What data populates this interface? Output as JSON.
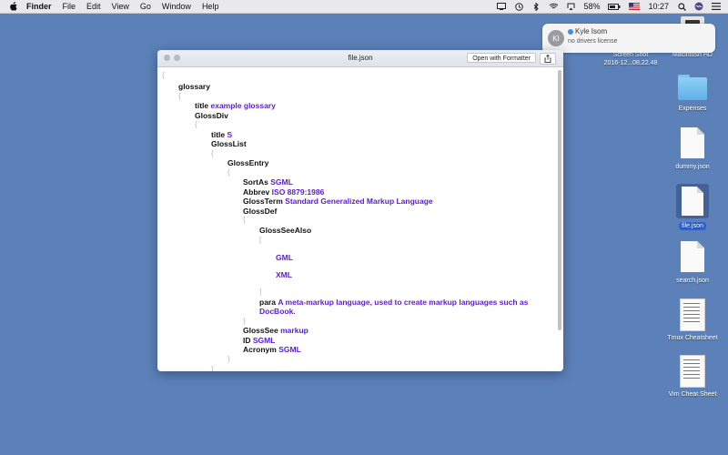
{
  "menubar": {
    "app_name": "Finder",
    "items": [
      "File",
      "Edit",
      "View",
      "Go",
      "Window",
      "Help"
    ],
    "battery": "58%",
    "time": "10:27"
  },
  "notification": {
    "initials": "KI",
    "title": "Kyle Isom",
    "message": "no drivers license"
  },
  "desktop": {
    "icons": [
      {
        "label_lines": [
          "Screen Shot",
          "2016-12...08.22.48"
        ]
      },
      {
        "label_lines": [
          "Macintosh HD"
        ]
      },
      {
        "label_lines": [
          "Expenses"
        ]
      },
      {
        "label_lines": [
          "dummy.json"
        ]
      },
      {
        "label_lines": [
          "file.json"
        ]
      },
      {
        "label_lines": [
          "search.json"
        ]
      },
      {
        "label_lines": [
          "Tmux Cheatsheet"
        ]
      },
      {
        "label_lines": [
          "Vim Cheat Sheet"
        ]
      }
    ]
  },
  "window": {
    "title": "file.json",
    "format_button": "Open with Formatter"
  },
  "json_tree": {
    "open_brace": "{",
    "close_brace": "}",
    "open_bracket": "[",
    "close_bracket": "]",
    "glossary_key": "glossary",
    "title_key": "title",
    "title_val": "example glossary",
    "glossdiv_key": "GlossDiv",
    "glossdiv_title_key": "title",
    "glossdiv_title_val": "S",
    "glosslist_key": "GlossList",
    "glossentry_key": "GlossEntry",
    "sortas_key": "SortAs",
    "sortas_val": "SGML",
    "abbrev_key": "Abbrev",
    "abbrev_val": "ISO 8879:1986",
    "glossterm_key": "GlossTerm",
    "glossterm_val": "Standard Generalized Markup Language",
    "glossdef_key": "GlossDef",
    "glossseealso_key": "GlossSeeAlso",
    "seealso_1": "GML",
    "seealso_2": "XML",
    "para_key": "para",
    "para_val_1": "A meta-markup language, used to create markup languages such as",
    "para_val_2": "DocBook.",
    "glosssee_key": "GlossSee",
    "glosssee_val": "markup",
    "id_key": "ID",
    "id_val": "SGML",
    "acronym_key": "Acronym",
    "acronym_val": "SGML"
  }
}
